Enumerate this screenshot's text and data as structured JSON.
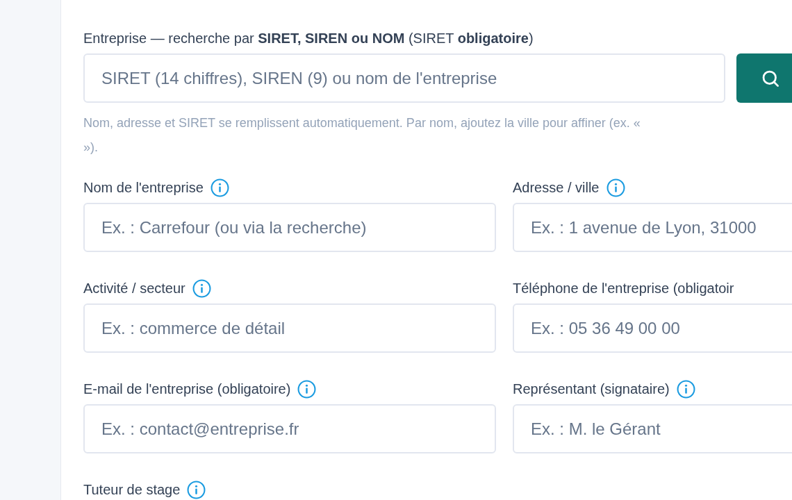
{
  "search": {
    "label": "Entreprise — recherche par **SIRET, SIREN ou NOM** (SIRET **obligatoire**)",
    "placeholder": "SIRET (14 chiffres), SIREN (9) ou nom de l'entreprise",
    "hint_lines": [
      "Nom, adresse et SIRET se remplissent automatiquement. Par nom, ajoutez la ville pour affiner (ex. «",
      "»)."
    ]
  },
  "fields": [
    {
      "label": "Nom de l'entreprise",
      "info": true,
      "placeholder": "Ex. : Carrefour (ou via la recherche)"
    },
    {
      "label": "Adresse / ville",
      "info": true,
      "placeholder": "Ex. : 1 avenue de Lyon, 31000"
    },
    {
      "label": "Activité / secteur",
      "info": true,
      "placeholder": "Ex. : commerce de détail"
    },
    {
      "label": "Téléphone de l'entreprise (obligatoir",
      "info": false,
      "placeholder": "Ex. : 05 36 49 00 00"
    },
    {
      "label": "E-mail de l'entreprise (obligatoire)",
      "info": true,
      "placeholder": "Ex. : contact@entreprise.fr"
    },
    {
      "label": "Représentant (signataire)",
      "info": true,
      "placeholder": "Ex. : M. le Gérant"
    },
    {
      "label": "Tuteur de stage",
      "info": true
    }
  ]
}
